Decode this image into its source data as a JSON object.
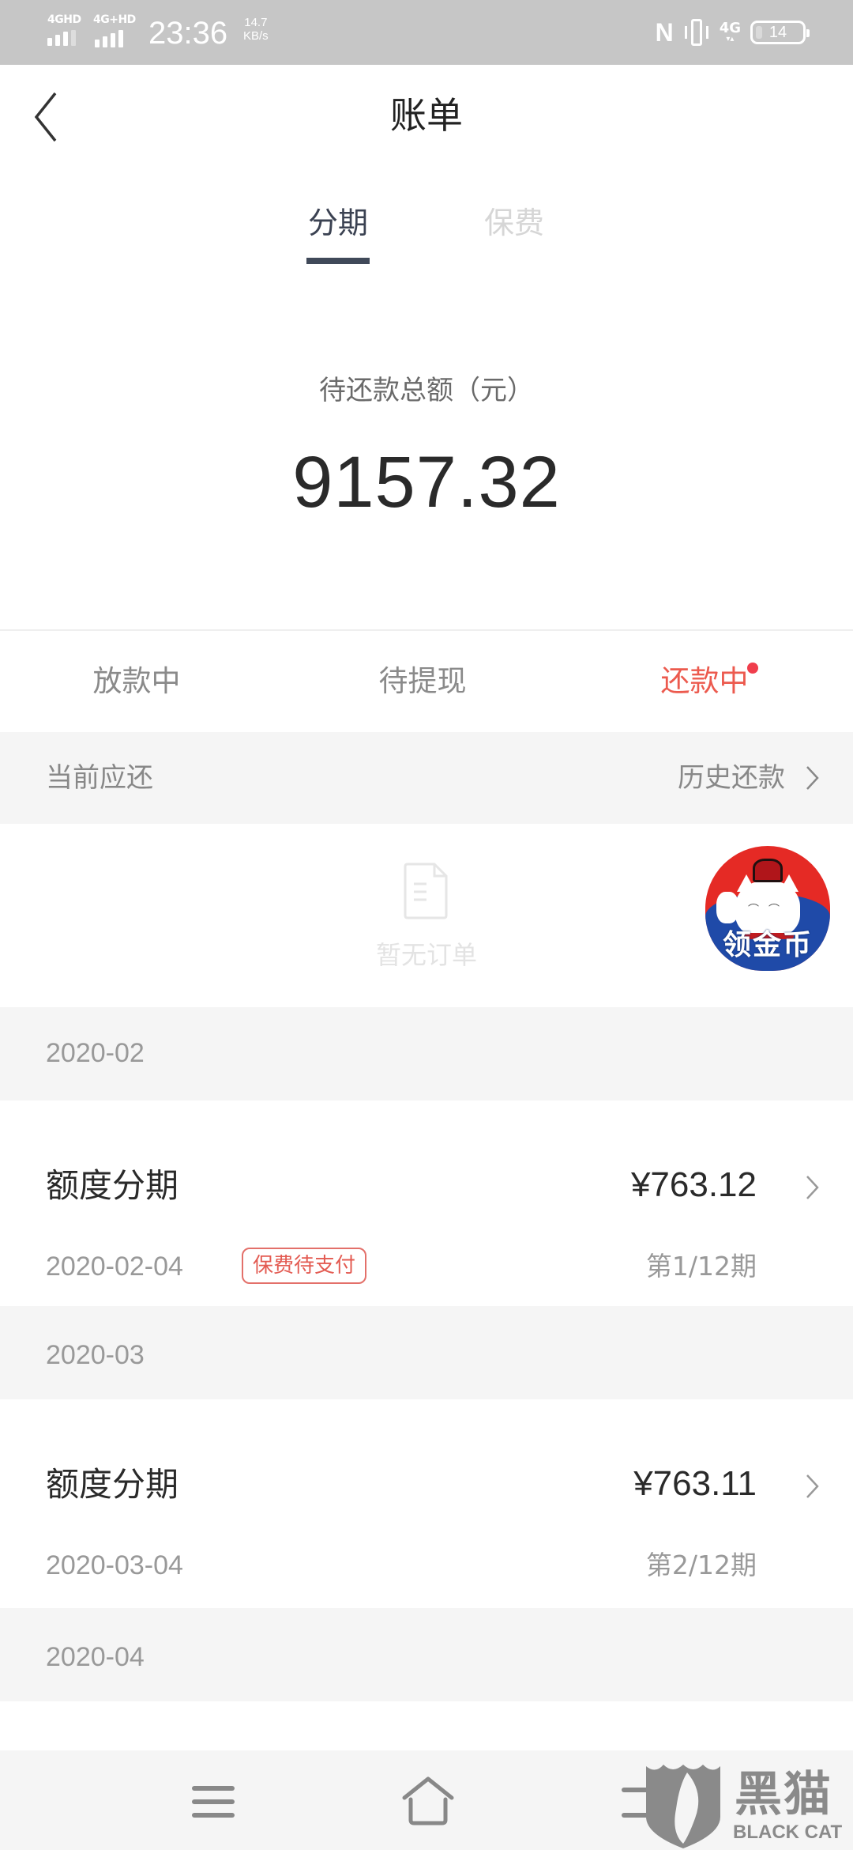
{
  "status_bar": {
    "network1": "4GHD",
    "network2": "4G+HD",
    "time": "23:36",
    "speed_value": "14.7",
    "speed_unit": "KB/s",
    "nfc": "N",
    "cell_type": "4G",
    "battery": "14",
    "battery_level_percent": 14
  },
  "header": {
    "title": "账单",
    "back_icon": "chevron-left-icon"
  },
  "segment_tabs": [
    {
      "label": "分期",
      "active": true
    },
    {
      "label": "保费",
      "active": false
    }
  ],
  "summary": {
    "label": "待还款总额（元）",
    "amount": "9157.32"
  },
  "status_tabs": [
    {
      "label": "放款中",
      "active": false
    },
    {
      "label": "待提现",
      "active": false
    },
    {
      "label": "还款中",
      "active": true,
      "has_dot": true
    }
  ],
  "current_section": {
    "label": "当前应还",
    "history_link": "历史还款"
  },
  "empty_state": {
    "icon": "document-icon",
    "text": "暂无订单"
  },
  "promo_badge": {
    "label": "领金币",
    "icon": "lucky-cat-icon"
  },
  "months": [
    {
      "month": "2020-02",
      "items": [
        {
          "name": "额度分期",
          "amount": "¥763.12",
          "date": "2020-02-04",
          "tag": "保费待支付",
          "period": "第1/12期"
        }
      ]
    },
    {
      "month": "2020-03",
      "items": [
        {
          "name": "额度分期",
          "amount": "¥763.11",
          "date": "2020-03-04",
          "tag": null,
          "period": "第2/12期"
        }
      ]
    },
    {
      "month": "2020-04",
      "items": []
    }
  ],
  "nav_bar": {
    "buttons": [
      "menu-icon",
      "home-icon",
      "back-icon"
    ]
  },
  "watermark": {
    "text": "黑猫",
    "sub": "BLACK CAT"
  },
  "colors": {
    "accent_red": "#ec5a4e",
    "dot_red": "#f03e4c",
    "tab_active": "#3b4252",
    "section_bg": "#f5f5f5",
    "status_bar_bg": "#c6c6c6"
  }
}
